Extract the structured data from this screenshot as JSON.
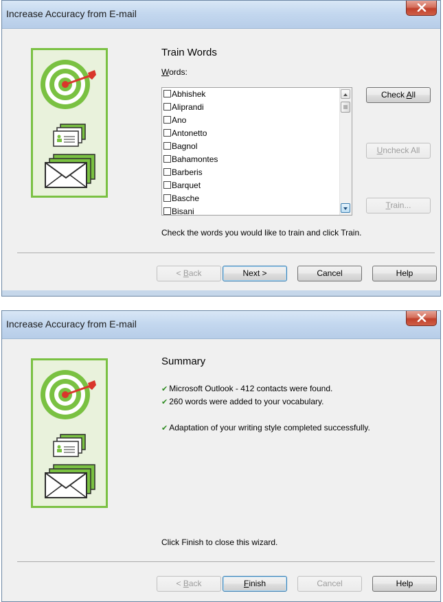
{
  "colors": {
    "accent_green": "#7ac142",
    "titlebar": "#c4d8ef",
    "close_red": "#c0402b",
    "check_green": "#2e8b21"
  },
  "window1": {
    "title": "Increase Accuracy from E-mail",
    "heading": "Train Words",
    "words_label_accel": "W",
    "words_label_rest": "ords:",
    "words": [
      "Abhishek",
      "Aliprandi",
      "Ano",
      "Antonetto",
      "Bagnol",
      "Bahamontes",
      "Barberis",
      "Barquet",
      "Basche",
      "Bisani"
    ],
    "buttons": {
      "check_all_pre": "Check ",
      "check_all_accel": "A",
      "check_all_post": "ll",
      "uncheck_all_accel": "U",
      "uncheck_all_post": "ncheck All",
      "train_accel": "T",
      "train_post": "rain...",
      "back_pre": "< ",
      "back_accel": "B",
      "back_post": "ack",
      "next": "Next >",
      "cancel": "Cancel",
      "help": "Help"
    },
    "instruction": "Check the words you would like to train and click Train."
  },
  "window2": {
    "title": "Increase Accuracy from E-mail",
    "heading": "Summary",
    "lines": [
      "Microsoft Outlook - 412 contacts were found.",
      "260 words were added to your vocabulary.",
      "Adaptation of your writing style completed successfully."
    ],
    "check_icon": "checkmark-icon",
    "instruction": "Click Finish to close this wizard.",
    "buttons": {
      "back_pre": "< ",
      "back_accel": "B",
      "back_post": "ack",
      "finish_accel": "F",
      "finish_post": "inish",
      "cancel": "Cancel",
      "help": "Help"
    }
  }
}
